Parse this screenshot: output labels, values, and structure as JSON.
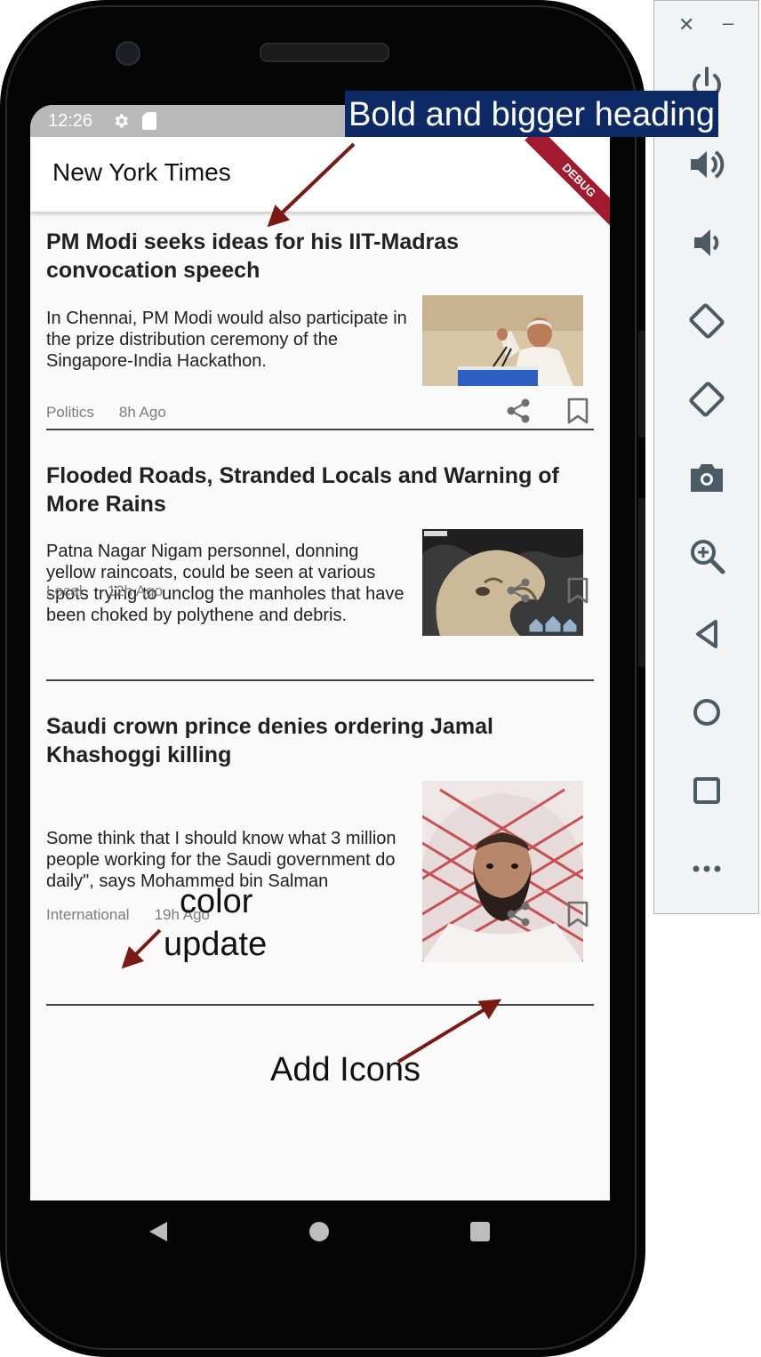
{
  "status_bar": {
    "time": "12:26"
  },
  "app_bar": {
    "title": "New York Times",
    "debug_label": "DEBUG"
  },
  "articles": [
    {
      "title": "PM Modi seeks ideas for his IIT-Madras convocation speech",
      "summary": "In Chennai, PM Modi would also participate in the prize distribution ceremony of the Singapore-India Hackathon.",
      "category": "Politics",
      "time": "8h Ago"
    },
    {
      "title": "Flooded Roads, Stranded Locals and Warning of More Rains",
      "summary": "Patna Nagar Nigam personnel, donning yellow raincoats, could be seen at various spots trying to unclog the manholes that have been choked by polythene and debris.",
      "category": "Local",
      "time": "12h Ago"
    },
    {
      "title": "Saudi crown prince denies ordering Jamal Khashoggi killing",
      "summary": "Some think that I should know what 3 million people working for the Saudi government do daily\", says Mohammed bin Salman",
      "category": "International",
      "time": "19h Ago"
    }
  ],
  "annotations": {
    "heading_note": "Bold and bigger heading",
    "color_note_line1": "color",
    "color_note_line2": "update",
    "icons_note": "Add Icons"
  },
  "colors": {
    "annotation_arrow": "#7a1a12",
    "heading_note_bg": "#0d2a66",
    "meta_text": "#7c7c7c",
    "icon_gray": "#6f6f6f"
  },
  "emulator_toolbar": {
    "icons": [
      "close-icon",
      "minimize-icon",
      "power-icon",
      "volume-up-icon",
      "volume-down-icon",
      "rotate-left-icon",
      "rotate-right-icon",
      "camera-icon",
      "zoom-icon",
      "back-icon",
      "home-icon",
      "overview-icon",
      "more-icon"
    ]
  }
}
